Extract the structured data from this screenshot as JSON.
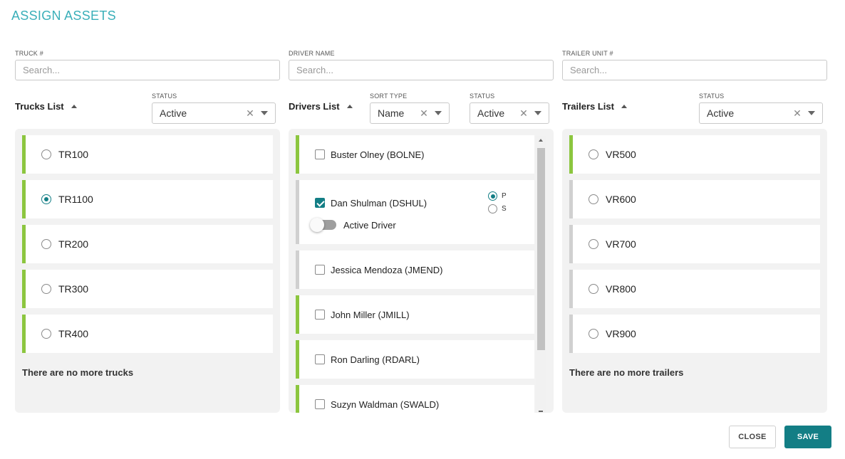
{
  "title": "ASSIGN ASSETS",
  "trucks": {
    "field_label": "TRUCK #",
    "search_placeholder": "Search...",
    "list_title": "Trucks List",
    "status_label": "STATUS",
    "status_value": "Active",
    "items": [
      {
        "label": "TR100",
        "selected": false,
        "status": "green"
      },
      {
        "label": "TR1100",
        "selected": true,
        "status": "green"
      },
      {
        "label": "TR200",
        "selected": false,
        "status": "green"
      },
      {
        "label": "TR300",
        "selected": false,
        "status": "green"
      },
      {
        "label": "TR400",
        "selected": false,
        "status": "green"
      }
    ],
    "empty_message": "There are no more trucks"
  },
  "drivers": {
    "field_label": "DRIVER NAME",
    "search_placeholder": "Search...",
    "list_title": "Drivers List",
    "sort_type_label": "SORT TYPE",
    "sort_type_value": "Name",
    "status_label": "STATUS",
    "status_value": "Active",
    "items": [
      {
        "label": "Buster Olney (BOLNE)",
        "checked": false,
        "status": "green"
      },
      {
        "label": "Dan Shulman (DSHUL)",
        "checked": true,
        "status": "gray",
        "primary_label": "P",
        "secondary_label": "S",
        "primary_selected": true,
        "active_driver_label": "Active Driver"
      },
      {
        "label": "Jessica Mendoza (JMEND)",
        "checked": false,
        "status": "gray"
      },
      {
        "label": "John Miller (JMILL)",
        "checked": false,
        "status": "green"
      },
      {
        "label": "Ron Darling (RDARL)",
        "checked": false,
        "status": "green"
      },
      {
        "label": "Suzyn Waldman (SWALD)",
        "checked": false,
        "status": "green"
      }
    ]
  },
  "trailers": {
    "field_label": "TRAILER UNIT #",
    "search_placeholder": "Search...",
    "list_title": "Trailers List",
    "status_label": "STATUS",
    "status_value": "Active",
    "items": [
      {
        "label": "VR500",
        "selected": false,
        "status": "green"
      },
      {
        "label": "VR600",
        "selected": false,
        "status": "gray"
      },
      {
        "label": "VR700",
        "selected": false,
        "status": "gray"
      },
      {
        "label": "VR800",
        "selected": false,
        "status": "gray"
      },
      {
        "label": "VR900",
        "selected": false,
        "status": "gray"
      }
    ],
    "empty_message": "There are no more trailers"
  },
  "buttons": {
    "close": "CLOSE",
    "save": "SAVE"
  },
  "colors": {
    "accent": "#137e85",
    "title": "#3aafb9",
    "status_green": "#8cc63f",
    "status_gray": "#d0d0d0"
  },
  "icons": {
    "clear": "close-x-icon",
    "dropdown": "chevron-down-icon",
    "sort": "sort-ascending-icon"
  }
}
